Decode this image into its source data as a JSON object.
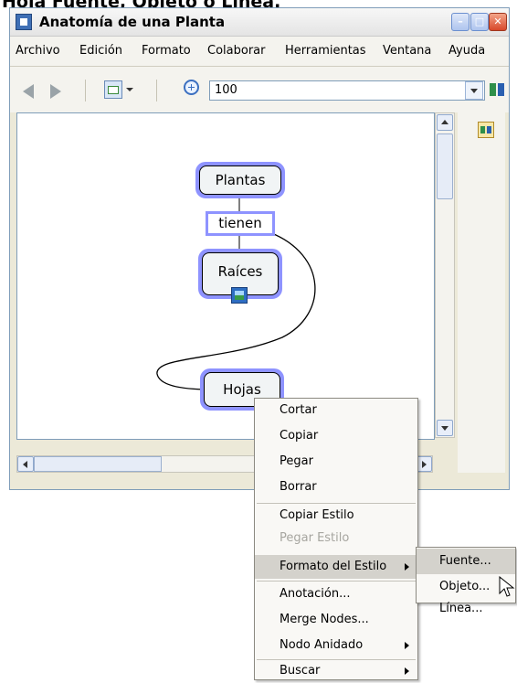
{
  "caption": "Hoja Fuente, Objeto o Línea.",
  "window": {
    "title": "Anatomía de una Planta",
    "controls": [
      "minimize",
      "maximize",
      "close"
    ]
  },
  "menubar": [
    "Archivo",
    "Edición",
    "Formato",
    "Colaborar",
    "Herramientas",
    "Ventana",
    "Ayuda"
  ],
  "toolbar": {
    "zoom_value": "100",
    "icons": [
      "back-arrow-icon",
      "forward-arrow-icon",
      "view-icon",
      "zoom-in-icon",
      "collaboration-icon"
    ]
  },
  "concept_map": {
    "nodes": [
      "Plantas",
      "Raíces",
      "Hojas"
    ],
    "link_phrase": "tienen",
    "node_border_color": "#8e93ff"
  },
  "context_menu": {
    "items": [
      {
        "label": "Cortar"
      },
      {
        "label": "Copiar"
      },
      {
        "label": "Pegar"
      },
      {
        "label": "Borrar"
      },
      {
        "label": "Copiar Estilo"
      },
      {
        "label": "Pegar Estilo",
        "disabled": true
      },
      {
        "label": "Formato del Estilo",
        "submenu": true,
        "active": true
      },
      {
        "label": "Anotación..."
      },
      {
        "label": "Merge Nodes..."
      },
      {
        "label": "Nodo Anidado",
        "submenu": true
      },
      {
        "label": "Buscar",
        "submenu": true
      }
    ],
    "submenu": {
      "items": [
        "Fuente...",
        "Objeto...",
        "Línea..."
      ],
      "active": "Fuente..."
    }
  }
}
